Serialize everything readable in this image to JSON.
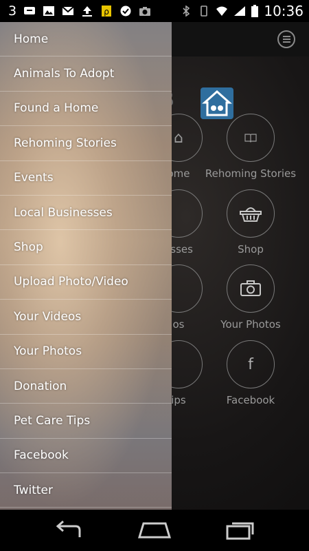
{
  "status_bar": {
    "notification_count": "3",
    "time": "10:36",
    "icons": [
      "sms-icon",
      "image-icon",
      "gmail-icon",
      "upload-icon",
      "app-icon",
      "check-icon",
      "camera-icon",
      "bluetooth-icon",
      "vibrate-icon",
      "wifi-icon",
      "signal-icon",
      "battery-icon"
    ]
  },
  "drawer": {
    "items": [
      "Home",
      "Animals To Adopt",
      "Found a Home",
      "Rehoming Stories",
      "Events",
      "Local Businesses",
      "Shop",
      "Upload Photo/Video",
      "Your Videos",
      "Your Photos",
      "Donation",
      "Pet Care Tips",
      "Facebook",
      "Twitter"
    ]
  },
  "background": {
    "logo_fragment": "gs",
    "tiles": [
      {
        "label": "ome",
        "icon": "home-icon"
      },
      {
        "label": "Rehoming Stories",
        "icon": "book-icon"
      },
      {
        "label": "esses",
        "icon": "business-icon"
      },
      {
        "label": "Shop",
        "icon": "basket-icon"
      },
      {
        "label": "os",
        "icon": "video-icon"
      },
      {
        "label": "Your Photos",
        "icon": "camera-icon"
      },
      {
        "label": "ips",
        "icon": "tips-icon"
      },
      {
        "label": "Facebook",
        "icon": "facebook-icon"
      }
    ]
  },
  "colors": {
    "accent_blue": "#2f6e9e",
    "drawer_text": "#ffffff"
  }
}
